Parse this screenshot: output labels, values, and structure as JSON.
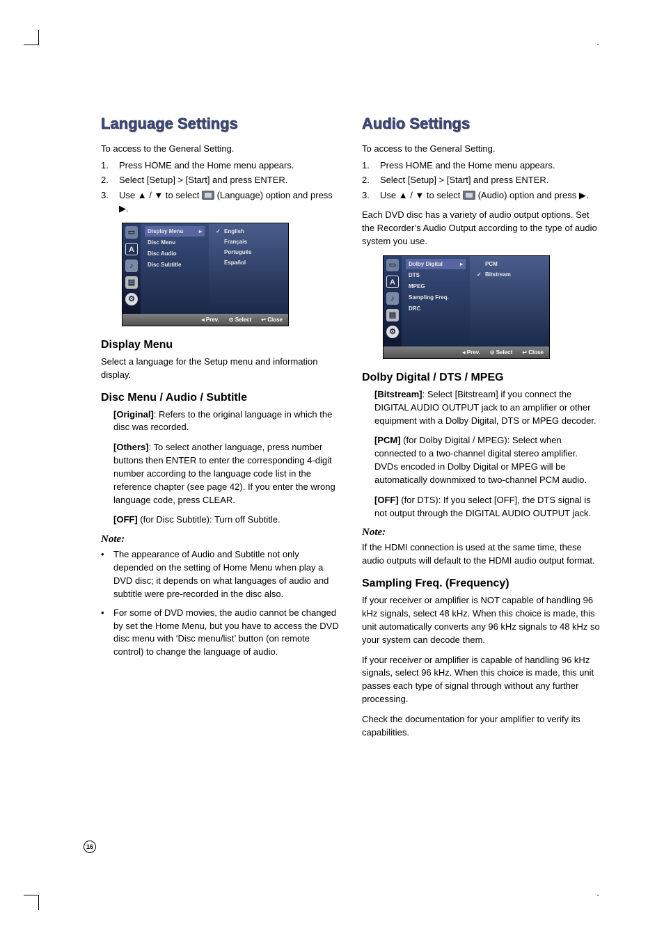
{
  "page_number": "16",
  "left": {
    "title": "Language Settings",
    "intro": "To access to the General Setting.",
    "steps": [
      "Press HOME and the Home menu appears.",
      "Select [Setup] > [Start] and press ENTER.",
      "Use ▲ / ▼ to select ",
      " (Language) option and press ▶."
    ],
    "screenshot": {
      "menu": [
        {
          "label": "Display Menu",
          "selected": true
        },
        {
          "label": "Disc Menu"
        },
        {
          "label": "Disc Audio"
        },
        {
          "label": "Disc Subtitle"
        }
      ],
      "options": [
        {
          "label": "English",
          "checked": true
        },
        {
          "label": "Français"
        },
        {
          "label": "Português"
        },
        {
          "label": "Español"
        }
      ],
      "footer": {
        "prev": "Prev.",
        "select": "Select",
        "close": "Close"
      }
    },
    "display_menu": {
      "heading": "Display Menu",
      "text": "Select a language for the Setup menu and information display."
    },
    "disc_menu": {
      "heading": "Disc Menu / Audio / Subtitle",
      "original_label": "[Original]",
      "original_text": ": Refers to the original language in which the disc was recorded.",
      "others_label": "[Others]",
      "others_text": ": To select another language, press number buttons then ENTER to enter the corresponding 4-digit number according to the language code list in the reference chapter (see page 42). If you enter the wrong language code, press CLEAR.",
      "off_label": "[OFF]",
      "off_text": " (for Disc Subtitle): Turn off Subtitle."
    },
    "note": {
      "heading": "Note:",
      "bullets": [
        "The appearance of Audio and Subtitle not only depended on the setting of Home Menu when play a DVD disc; it depends on what languages of audio and subtitle were pre-recorded in the disc also.",
        "For some of DVD movies, the audio cannot be changed by set the Home Menu, but you have to access the DVD disc menu with ‘Disc menu/list’ button (on remote control) to change the language of audio."
      ]
    }
  },
  "right": {
    "title": "Audio Settings",
    "intro": "To access to the General Setting.",
    "steps": [
      "Press HOME and the Home menu appears.",
      "Select [Setup] > [Start] and press ENTER.",
      "Use ▲ / ▼ to select ",
      " (Audio) option and press ▶."
    ],
    "desc": "Each DVD disc has a variety of audio output options. Set the Recorder’s Audio Output according to the type of audio system you use.",
    "screenshot": {
      "menu": [
        {
          "label": "Dolby Digital",
          "selected": true
        },
        {
          "label": "DTS"
        },
        {
          "label": "MPEG"
        },
        {
          "label": "Sampling Freq."
        },
        {
          "label": "DRC"
        }
      ],
      "options": [
        {
          "label": "PCM"
        },
        {
          "label": "Bitstream",
          "checked": true
        }
      ],
      "footer": {
        "prev": "Prev.",
        "select": "Select",
        "close": "Close"
      }
    },
    "dolby": {
      "heading": "Dolby Digital / DTS / MPEG",
      "bitstream_label": "[Bitstream]",
      "bitstream_text": ": Select [Bitstream] if you connect the DIGITAL AUDIO OUTPUT jack to an amplifier or other equipment with a Dolby Digital, DTS or MPEG decoder.",
      "pcm_label": "[PCM]",
      "pcm_text": " (for Dolby Digital / MPEG): Select when connected to a two-channel digital stereo amplifier. DVDs encoded in Dolby Digital or MPEG will be automatically downmixed to two-channel PCM audio.",
      "off_label": "[OFF]",
      "off_text": " (for DTS): If you select [OFF], the DTS signal is not output through the DIGITAL AUDIO OUTPUT jack."
    },
    "note": {
      "heading": "Note:",
      "text": "If the HDMI connection is used at the same time, these audio outputs will default to the HDMI audio output format."
    },
    "sampling": {
      "heading": "Sampling Freq. (Frequency)",
      "p1": "If your receiver or amplifier is NOT capable of handling 96 kHz signals, select 48 kHz. When this choice is made, this unit automatically converts any 96 kHz signals to 48 kHz so your system can decode them.",
      "p2": "If your receiver or amplifier is capable of handling 96 kHz signals, select 96 kHz. When this choice is made, this unit passes each type of signal through without any further processing.",
      "p3": "Check the documentation for your amplifier to verify its capabilities."
    }
  }
}
